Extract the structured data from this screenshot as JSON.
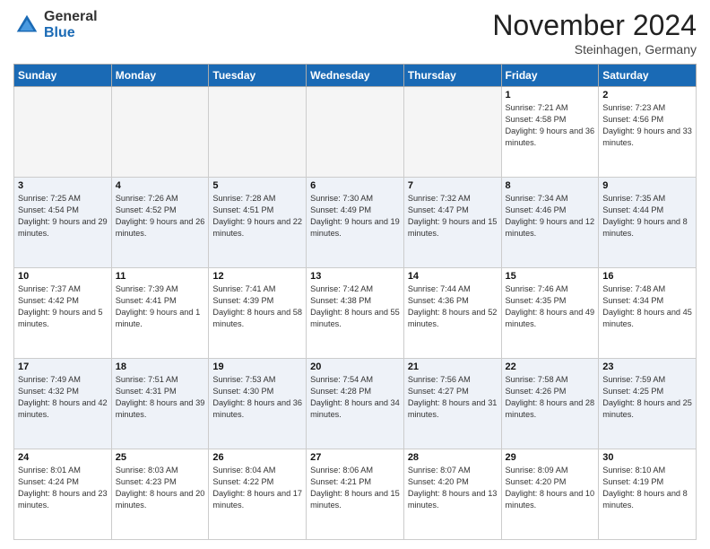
{
  "logo": {
    "general": "General",
    "blue": "Blue"
  },
  "header": {
    "month_title": "November 2024",
    "location": "Steinhagen, Germany"
  },
  "weekdays": [
    "Sunday",
    "Monday",
    "Tuesday",
    "Wednesday",
    "Thursday",
    "Friday",
    "Saturday"
  ],
  "weeks": [
    [
      {
        "day": "",
        "empty": true
      },
      {
        "day": "",
        "empty": true
      },
      {
        "day": "",
        "empty": true
      },
      {
        "day": "",
        "empty": true
      },
      {
        "day": "",
        "empty": true
      },
      {
        "day": "1",
        "sunrise": "7:21 AM",
        "sunset": "4:58 PM",
        "daylight": "9 hours and 36 minutes."
      },
      {
        "day": "2",
        "sunrise": "7:23 AM",
        "sunset": "4:56 PM",
        "daylight": "9 hours and 33 minutes."
      }
    ],
    [
      {
        "day": "3",
        "sunrise": "7:25 AM",
        "sunset": "4:54 PM",
        "daylight": "9 hours and 29 minutes."
      },
      {
        "day": "4",
        "sunrise": "7:26 AM",
        "sunset": "4:52 PM",
        "daylight": "9 hours and 26 minutes."
      },
      {
        "day": "5",
        "sunrise": "7:28 AM",
        "sunset": "4:51 PM",
        "daylight": "9 hours and 22 minutes."
      },
      {
        "day": "6",
        "sunrise": "7:30 AM",
        "sunset": "4:49 PM",
        "daylight": "9 hours and 19 minutes."
      },
      {
        "day": "7",
        "sunrise": "7:32 AM",
        "sunset": "4:47 PM",
        "daylight": "9 hours and 15 minutes."
      },
      {
        "day": "8",
        "sunrise": "7:34 AM",
        "sunset": "4:46 PM",
        "daylight": "9 hours and 12 minutes."
      },
      {
        "day": "9",
        "sunrise": "7:35 AM",
        "sunset": "4:44 PM",
        "daylight": "9 hours and 8 minutes."
      }
    ],
    [
      {
        "day": "10",
        "sunrise": "7:37 AM",
        "sunset": "4:42 PM",
        "daylight": "9 hours and 5 minutes."
      },
      {
        "day": "11",
        "sunrise": "7:39 AM",
        "sunset": "4:41 PM",
        "daylight": "9 hours and 1 minute."
      },
      {
        "day": "12",
        "sunrise": "7:41 AM",
        "sunset": "4:39 PM",
        "daylight": "8 hours and 58 minutes."
      },
      {
        "day": "13",
        "sunrise": "7:42 AM",
        "sunset": "4:38 PM",
        "daylight": "8 hours and 55 minutes."
      },
      {
        "day": "14",
        "sunrise": "7:44 AM",
        "sunset": "4:36 PM",
        "daylight": "8 hours and 52 minutes."
      },
      {
        "day": "15",
        "sunrise": "7:46 AM",
        "sunset": "4:35 PM",
        "daylight": "8 hours and 49 minutes."
      },
      {
        "day": "16",
        "sunrise": "7:48 AM",
        "sunset": "4:34 PM",
        "daylight": "8 hours and 45 minutes."
      }
    ],
    [
      {
        "day": "17",
        "sunrise": "7:49 AM",
        "sunset": "4:32 PM",
        "daylight": "8 hours and 42 minutes."
      },
      {
        "day": "18",
        "sunrise": "7:51 AM",
        "sunset": "4:31 PM",
        "daylight": "8 hours and 39 minutes."
      },
      {
        "day": "19",
        "sunrise": "7:53 AM",
        "sunset": "4:30 PM",
        "daylight": "8 hours and 36 minutes."
      },
      {
        "day": "20",
        "sunrise": "7:54 AM",
        "sunset": "4:28 PM",
        "daylight": "8 hours and 34 minutes."
      },
      {
        "day": "21",
        "sunrise": "7:56 AM",
        "sunset": "4:27 PM",
        "daylight": "8 hours and 31 minutes."
      },
      {
        "day": "22",
        "sunrise": "7:58 AM",
        "sunset": "4:26 PM",
        "daylight": "8 hours and 28 minutes."
      },
      {
        "day": "23",
        "sunrise": "7:59 AM",
        "sunset": "4:25 PM",
        "daylight": "8 hours and 25 minutes."
      }
    ],
    [
      {
        "day": "24",
        "sunrise": "8:01 AM",
        "sunset": "4:24 PM",
        "daylight": "8 hours and 23 minutes."
      },
      {
        "day": "25",
        "sunrise": "8:03 AM",
        "sunset": "4:23 PM",
        "daylight": "8 hours and 20 minutes."
      },
      {
        "day": "26",
        "sunrise": "8:04 AM",
        "sunset": "4:22 PM",
        "daylight": "8 hours and 17 minutes."
      },
      {
        "day": "27",
        "sunrise": "8:06 AM",
        "sunset": "4:21 PM",
        "daylight": "8 hours and 15 minutes."
      },
      {
        "day": "28",
        "sunrise": "8:07 AM",
        "sunset": "4:20 PM",
        "daylight": "8 hours and 13 minutes."
      },
      {
        "day": "29",
        "sunrise": "8:09 AM",
        "sunset": "4:20 PM",
        "daylight": "8 hours and 10 minutes."
      },
      {
        "day": "30",
        "sunrise": "8:10 AM",
        "sunset": "4:19 PM",
        "daylight": "8 hours and 8 minutes."
      }
    ]
  ]
}
